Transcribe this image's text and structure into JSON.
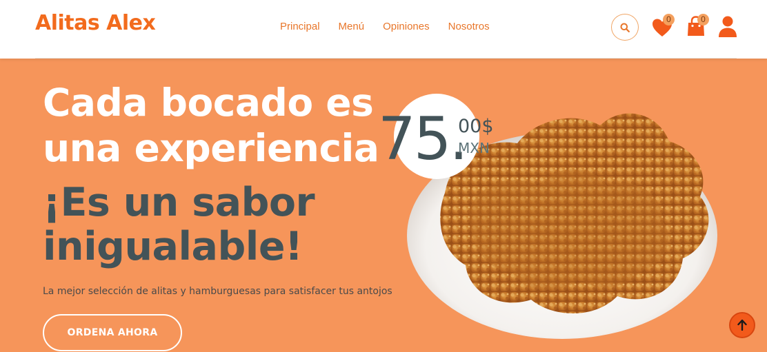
{
  "brand": {
    "name": "Alitas Alex"
  },
  "nav": {
    "items": [
      "Principal",
      "Menú",
      "Opiniones",
      "Nosotros"
    ]
  },
  "header_icons": {
    "search": "search-icon",
    "wishlist": {
      "icon": "heart-icon",
      "count": "0"
    },
    "cart": {
      "icon": "shopping-bag-icon",
      "count": "0"
    },
    "account": "user-icon"
  },
  "hero": {
    "title_line1": "Cada bocado es",
    "title_line2": "una experiencia",
    "subtitle_line1": "¡Es un sabor",
    "subtitle_line2": "inigualable!",
    "description": "La mejor selección de alitas y hamburguesas para satisfacer tus antojos",
    "cta_label": "ORDENA AHORA",
    "price_main": "75.",
    "price_cents": "00$",
    "price_currency": "MXN"
  },
  "colors": {
    "accent": "#f26b1d",
    "hero_bg": "#f6955a",
    "dark_text": "#435358",
    "scroll_top_bg": "#f25a1b"
  }
}
